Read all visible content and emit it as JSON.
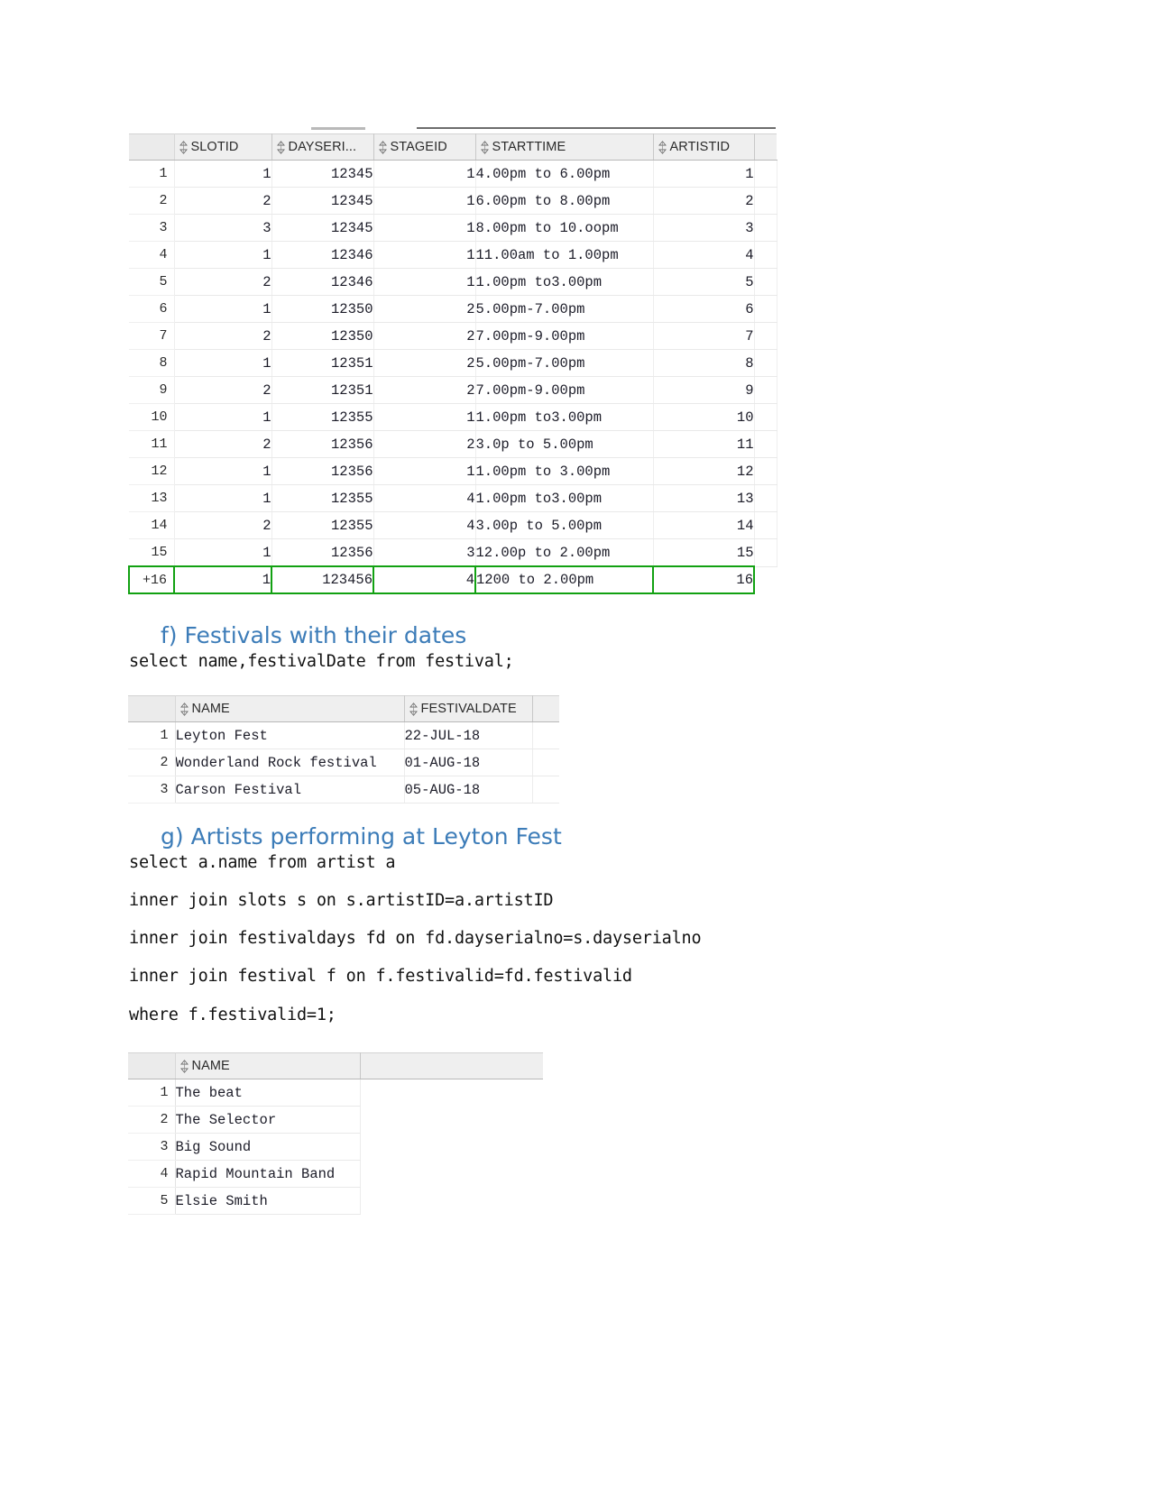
{
  "document": {
    "sections": [
      {
        "id": "slots-result",
        "type": "result-grid",
        "columns": [
          "SLOTID",
          "DAYSERI...",
          "STAGEID",
          "STARTTIME",
          "ARTISTID"
        ],
        "rows": [
          {
            "n": "1",
            "slotid": "1",
            "dayserialno": "12345",
            "stageid": "1",
            "starttime": "4.00pm to 6.00pm",
            "artistid": "1"
          },
          {
            "n": "2",
            "slotid": "2",
            "dayserialno": "12345",
            "stageid": "1",
            "starttime": "6.00pm to 8.00pm",
            "artistid": "2"
          },
          {
            "n": "3",
            "slotid": "3",
            "dayserialno": "12345",
            "stageid": "1",
            "starttime": "8.00pm to 10.oopm",
            "artistid": "3"
          },
          {
            "n": "4",
            "slotid": "1",
            "dayserialno": "12346",
            "stageid": "1",
            "starttime": "11.00am to 1.00pm",
            "artistid": "4"
          },
          {
            "n": "5",
            "slotid": "2",
            "dayserialno": "12346",
            "stageid": "1",
            "starttime": "1.00pm to3.00pm",
            "artistid": "5"
          },
          {
            "n": "6",
            "slotid": "1",
            "dayserialno": "12350",
            "stageid": "2",
            "starttime": "5.00pm-7.00pm",
            "artistid": "6"
          },
          {
            "n": "7",
            "slotid": "2",
            "dayserialno": "12350",
            "stageid": "2",
            "starttime": "7.00pm-9.00pm",
            "artistid": "7"
          },
          {
            "n": "8",
            "slotid": "1",
            "dayserialno": "12351",
            "stageid": "2",
            "starttime": "5.00pm-7.00pm",
            "artistid": "8"
          },
          {
            "n": "9",
            "slotid": "2",
            "dayserialno": "12351",
            "stageid": "2",
            "starttime": "7.00pm-9.00pm",
            "artistid": "9"
          },
          {
            "n": "10",
            "slotid": "1",
            "dayserialno": "12355",
            "stageid": "1",
            "starttime": "1.00pm to3.00pm",
            "artistid": "10"
          },
          {
            "n": "11",
            "slotid": "2",
            "dayserialno": "12356",
            "stageid": "2",
            "starttime": "3.0p to 5.00pm",
            "artistid": "11"
          },
          {
            "n": "12",
            "slotid": "1",
            "dayserialno": "12356",
            "stageid": "1",
            "starttime": "1.00pm to 3.00pm",
            "artistid": "12"
          },
          {
            "n": "13",
            "slotid": "1",
            "dayserialno": "12355",
            "stageid": "4",
            "starttime": "1.00pm to3.00pm",
            "artistid": "13"
          },
          {
            "n": "14",
            "slotid": "2",
            "dayserialno": "12355",
            "stageid": "4",
            "starttime": "3.00p to 5.00pm",
            "artistid": "14"
          },
          {
            "n": "15",
            "slotid": "1",
            "dayserialno": "12356",
            "stageid": "3",
            "starttime": "12.00p to 2.00pm",
            "artistid": "15"
          },
          {
            "n": "+16",
            "slotid": "1",
            "dayserialno": "123456",
            "stageid": "4",
            "starttime": "1200 to 2.00pm",
            "artistid": "16",
            "highlight": true
          }
        ]
      },
      {
        "id": "festivals",
        "heading": "f)  Festivals with their dates",
        "sql": [
          "select name,festivalDate from festival;"
        ],
        "columns": [
          "NAME",
          "FESTIVALDATE"
        ],
        "rows": [
          {
            "n": "1",
            "name": "Leyton Fest",
            "festivaldate": "22-JUL-18"
          },
          {
            "n": "2",
            "name": "Wonderland Rock festival",
            "festivaldate": "01-AUG-18"
          },
          {
            "n": "3",
            "name": "Carson Festival",
            "festivaldate": "05-AUG-18"
          }
        ]
      },
      {
        "id": "artists-leyton",
        "heading": "g) Artists performing at Leyton Fest",
        "sql": [
          "select a.name from artist a",
          "inner join slots s on s.artistID=a.artistID",
          "inner join festivaldays fd on fd.dayserialno=s.dayserialno",
          "inner join festival f on f.festivalid=fd.festivalid",
          "where f.festivalid=1;"
        ],
        "columns": [
          "NAME"
        ],
        "rows": [
          {
            "n": "1",
            "name": "The beat"
          },
          {
            "n": "2",
            "name": "The Selector"
          },
          {
            "n": "3",
            "name": "Big Sound"
          },
          {
            "n": "4",
            "name": "Rapid Mountain Band"
          },
          {
            "n": "5",
            "name": "Elsie Smith"
          }
        ]
      }
    ],
    "colors": {
      "heading": "#3c7cb8",
      "highlight_border": "#12a112",
      "header_bg": "#efefef",
      "text": "#121212"
    }
  }
}
